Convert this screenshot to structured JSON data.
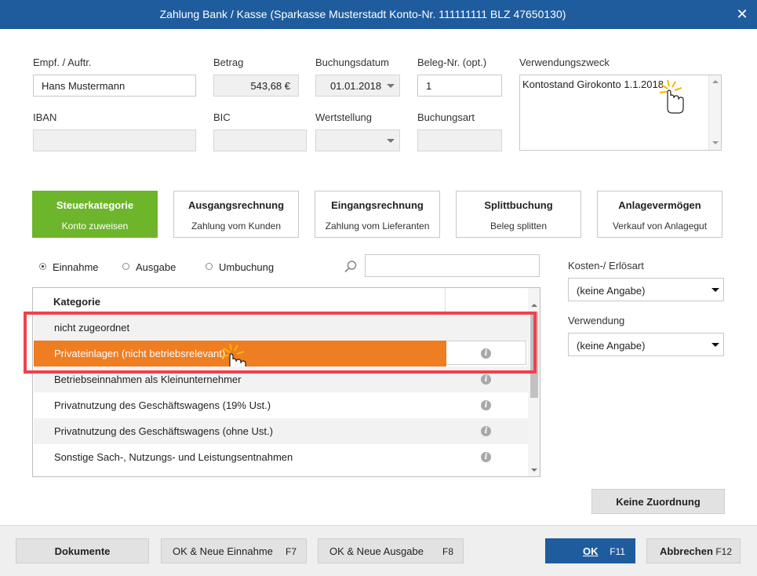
{
  "window": {
    "title": "Zahlung Bank / Kasse (Sparkasse Musterstadt Konto-Nr. 111111111  BLZ 47650130)",
    "close_glyph": "✕"
  },
  "form": {
    "empf_label": "Empf. / Auftr.",
    "empf_value": "Hans Mustermann",
    "betrag_label": "Betrag",
    "betrag_value": "543,68 €",
    "buchungsdatum_label": "Buchungsdatum",
    "buchungsdatum_value": "01.01.2018",
    "beleg_label": "Beleg-Nr. (opt.)",
    "beleg_value": "1",
    "verwendungszweck_label": "Verwendungszweck",
    "verwendungszweck_value": "Kontostand Girokonto 1.1.2018",
    "iban_label": "IBAN",
    "iban_value": "",
    "bic_label": "BIC",
    "bic_value": "",
    "wertstellung_label": "Wertstellung",
    "wertstellung_value": "",
    "buchungsart_label": "Buchungsart",
    "buchungsart_value": ""
  },
  "category_buttons": [
    {
      "title": "Steuerkategorie",
      "subtitle": "Konto zuweisen",
      "active": true
    },
    {
      "title": "Ausgangsrechnung",
      "subtitle": "Zahlung vom Kunden",
      "active": false
    },
    {
      "title": "Eingangsrechnung",
      "subtitle": "Zahlung vom Lieferanten",
      "active": false
    },
    {
      "title": "Splittbuchung",
      "subtitle": "Beleg splitten",
      "active": false
    },
    {
      "title": "Anlagevermögen",
      "subtitle": "Verkauf von Anlagegut",
      "active": false
    }
  ],
  "filter": {
    "radios": [
      {
        "label": "Einnahme",
        "selected": true
      },
      {
        "label": "Ausgabe",
        "selected": false
      },
      {
        "label": "Umbuchung",
        "selected": false
      }
    ],
    "search_value": ""
  },
  "category_table": {
    "header": "Kategorie",
    "rows": [
      {
        "label": "nicht zugeordnet",
        "info": false,
        "selected": false
      },
      {
        "label": "Privateinlagen  (nicht betriebsrelevant)",
        "info": true,
        "selected": true
      },
      {
        "label": "Betriebseinnahmen als Kleinunternehmer",
        "info": true,
        "selected": false
      },
      {
        "label": "Privatnutzung des Geschäftswagens (19% Ust.)",
        "info": true,
        "selected": false
      },
      {
        "label": "Privatnutzung des Geschäftswagens (ohne Ust.)",
        "info": true,
        "selected": false
      },
      {
        "label": "Sonstige Sach-, Nutzungs- und Leistungsentnahmen",
        "info": true,
        "selected": false
      }
    ],
    "info_glyph": "i"
  },
  "right_panel": {
    "kosten_label": "Kosten-/ Erlösart",
    "kosten_value": "(keine Angabe)",
    "verwendung_label": "Verwendung",
    "verwendung_value": "(keine Angabe)",
    "keine_zuordnung_label": "Keine Zuordnung"
  },
  "footer": {
    "dokumente_label": "Dokumente",
    "ok_neue_einnahme_label": "OK & Neue Einnahme",
    "ok_neue_einnahme_key": "F7",
    "ok_neue_ausgabe_label": "OK & Neue Ausgabe",
    "ok_neue_ausgabe_key": "F8",
    "ok_label": "OK",
    "ok_key": "F11",
    "abbrechen_label": "Abbrechen",
    "abbrechen_key": "F12"
  },
  "colors": {
    "titlebar": "#1f5c9e",
    "active_category": "#6db52b",
    "selected_row": "#ef7d22",
    "highlight_border": "#f0414c",
    "primary_button": "#1f5c9e"
  }
}
